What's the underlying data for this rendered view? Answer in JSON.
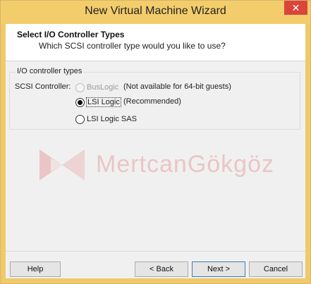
{
  "window": {
    "title": "New Virtual Machine Wizard",
    "close_glyph": "✕"
  },
  "header": {
    "title": "Select I/O Controller Types",
    "subtitle": "Which SCSI controller type would you like to use?"
  },
  "group": {
    "legend": "I/O controller types",
    "scsi_label": "SCSI Controller:",
    "options": [
      {
        "label": "BusLogic",
        "note": "(Not available for 64-bit guests)",
        "checked": false,
        "enabled": false
      },
      {
        "label": "LSI Logic",
        "note": "(Recommended)",
        "checked": true,
        "enabled": true
      },
      {
        "label": "LSI Logic SAS",
        "note": "",
        "checked": false,
        "enabled": true
      }
    ]
  },
  "watermark": {
    "text": "MertcanGökgöz",
    "icon": "mertcan-logo-icon"
  },
  "buttons": {
    "help": "Help",
    "back": "< Back",
    "next": "Next >",
    "cancel": "Cancel"
  }
}
